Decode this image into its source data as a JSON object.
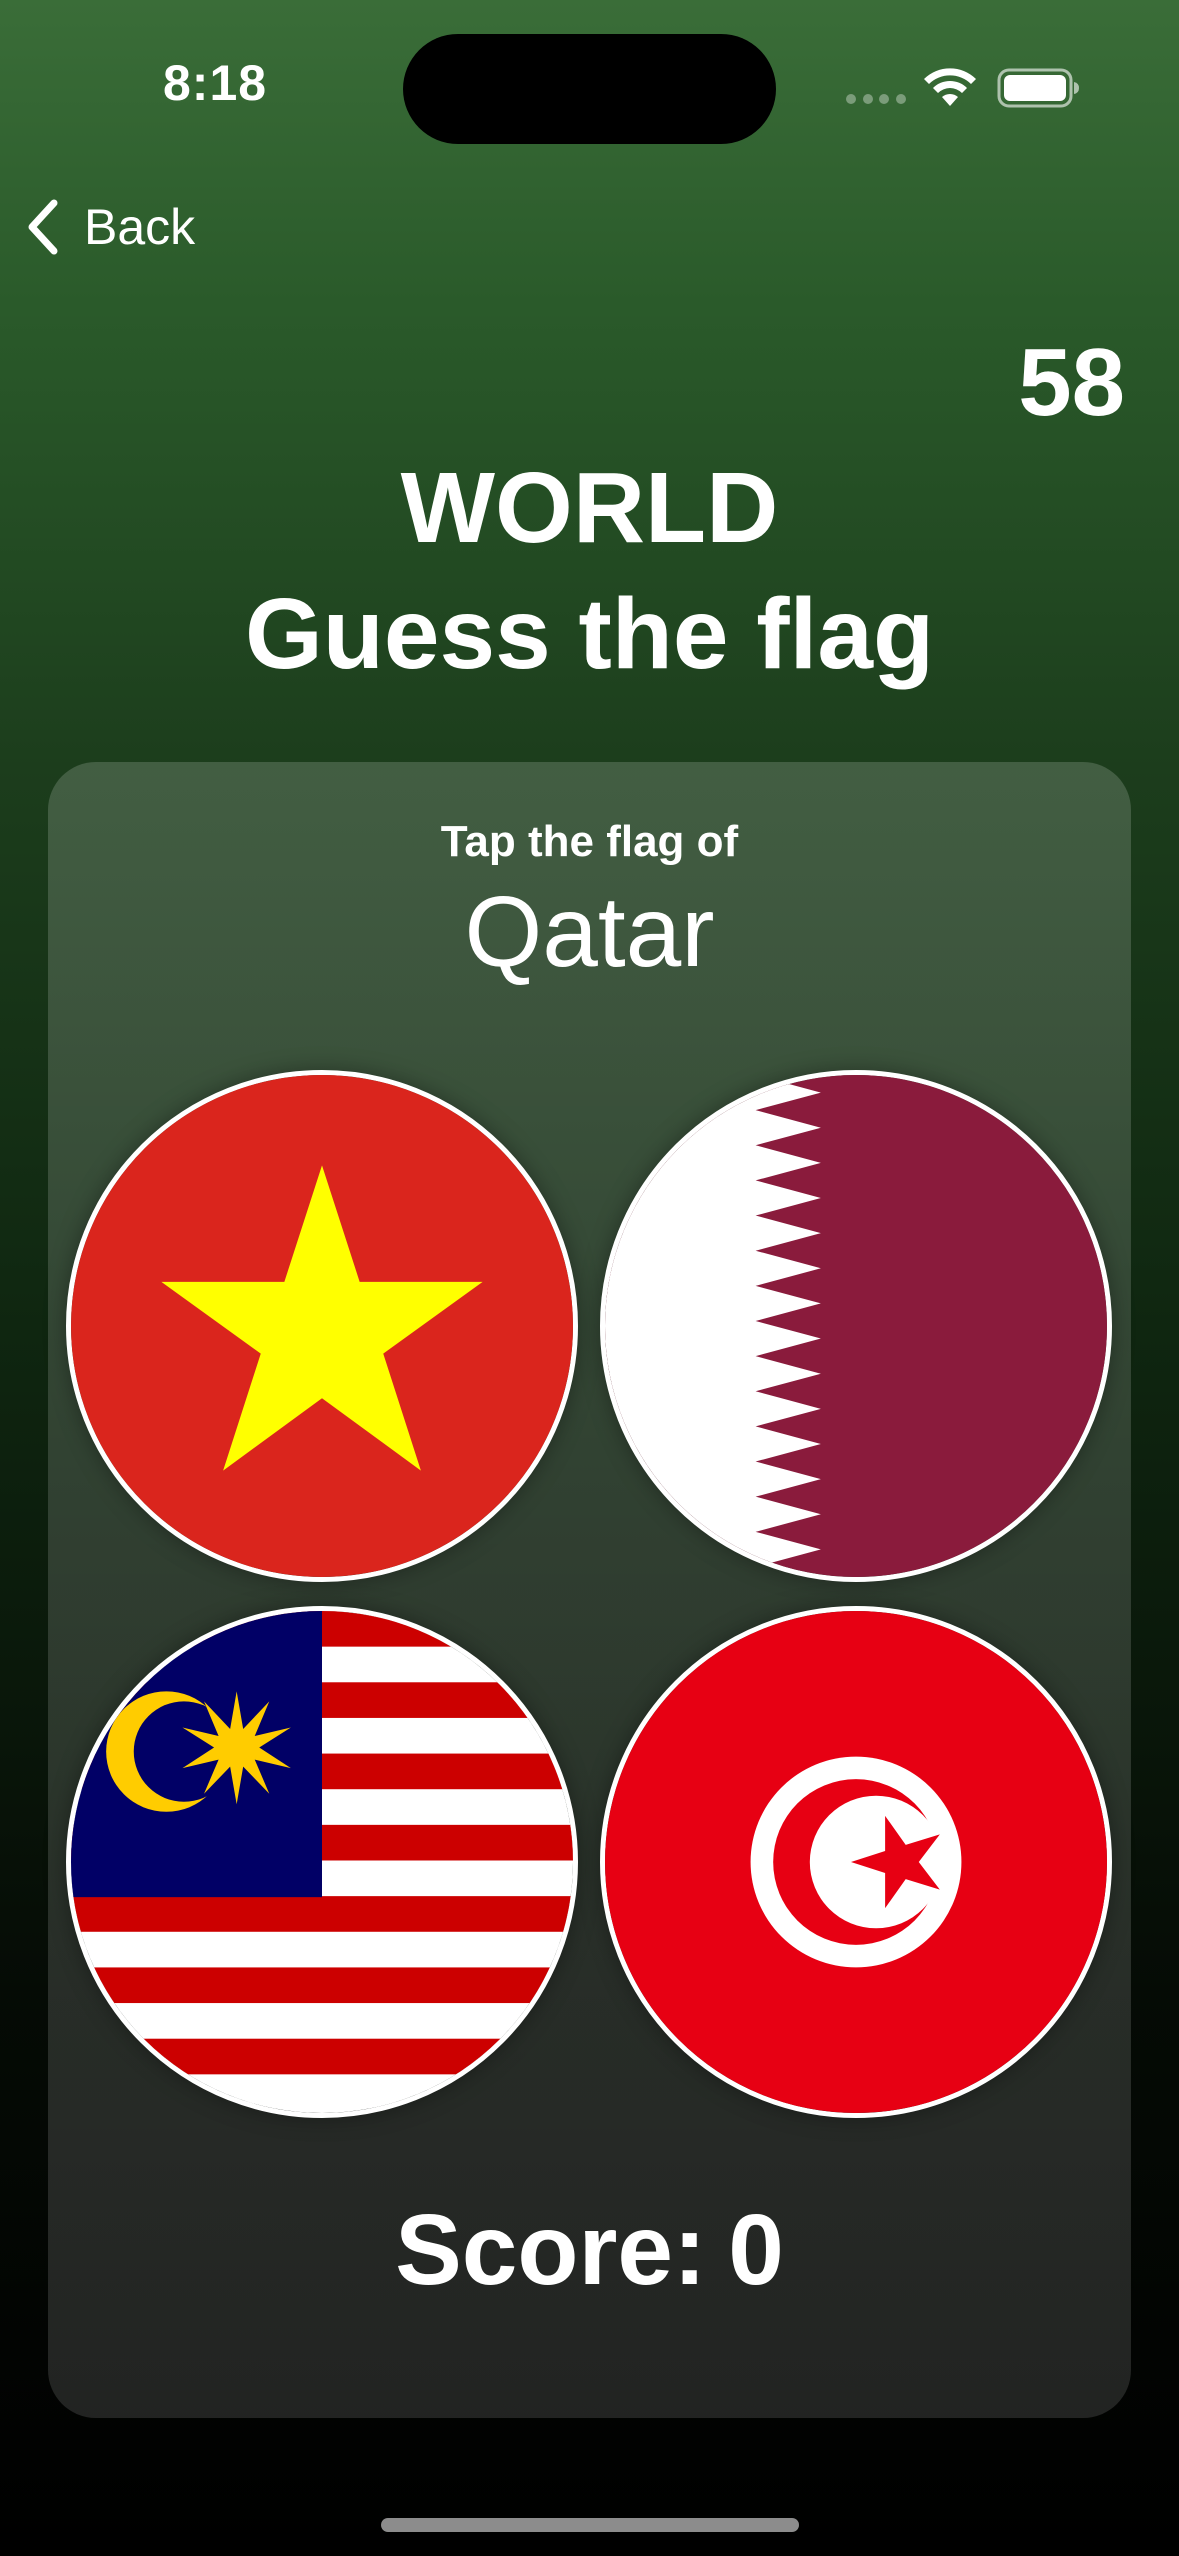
{
  "status_bar": {
    "time": "8:18",
    "icons": [
      "cellular-signal-icon",
      "wifi-icon",
      "battery-icon"
    ]
  },
  "nav": {
    "back_label": "Back",
    "back_icon": "chevron-left-icon"
  },
  "timer": {
    "value": "58"
  },
  "header": {
    "title": "WORLD",
    "subtitle": "Guess the flag"
  },
  "question": {
    "prompt": "Tap the flag of",
    "country": "Qatar"
  },
  "flags": [
    {
      "id": "vietnam",
      "icon": "vietnam-flag-icon"
    },
    {
      "id": "qatar",
      "icon": "qatar-flag-icon"
    },
    {
      "id": "malaysia",
      "icon": "malaysia-flag-icon"
    },
    {
      "id": "tunisia",
      "icon": "tunisia-flag-icon"
    }
  ],
  "score": {
    "label": "Score:",
    "value": "0"
  },
  "colors": {
    "background_top": "#3a6d38",
    "background_bottom": "#000000",
    "text": "#ffffff",
    "vietnam_red": "#da251d",
    "vietnam_yellow": "#ffff00",
    "qatar_maroon": "#8a1b3c",
    "malaysia_blue": "#010066",
    "malaysia_red": "#cc0000",
    "malaysia_yellow": "#ffcc00",
    "tunisia_red": "#e70013"
  }
}
